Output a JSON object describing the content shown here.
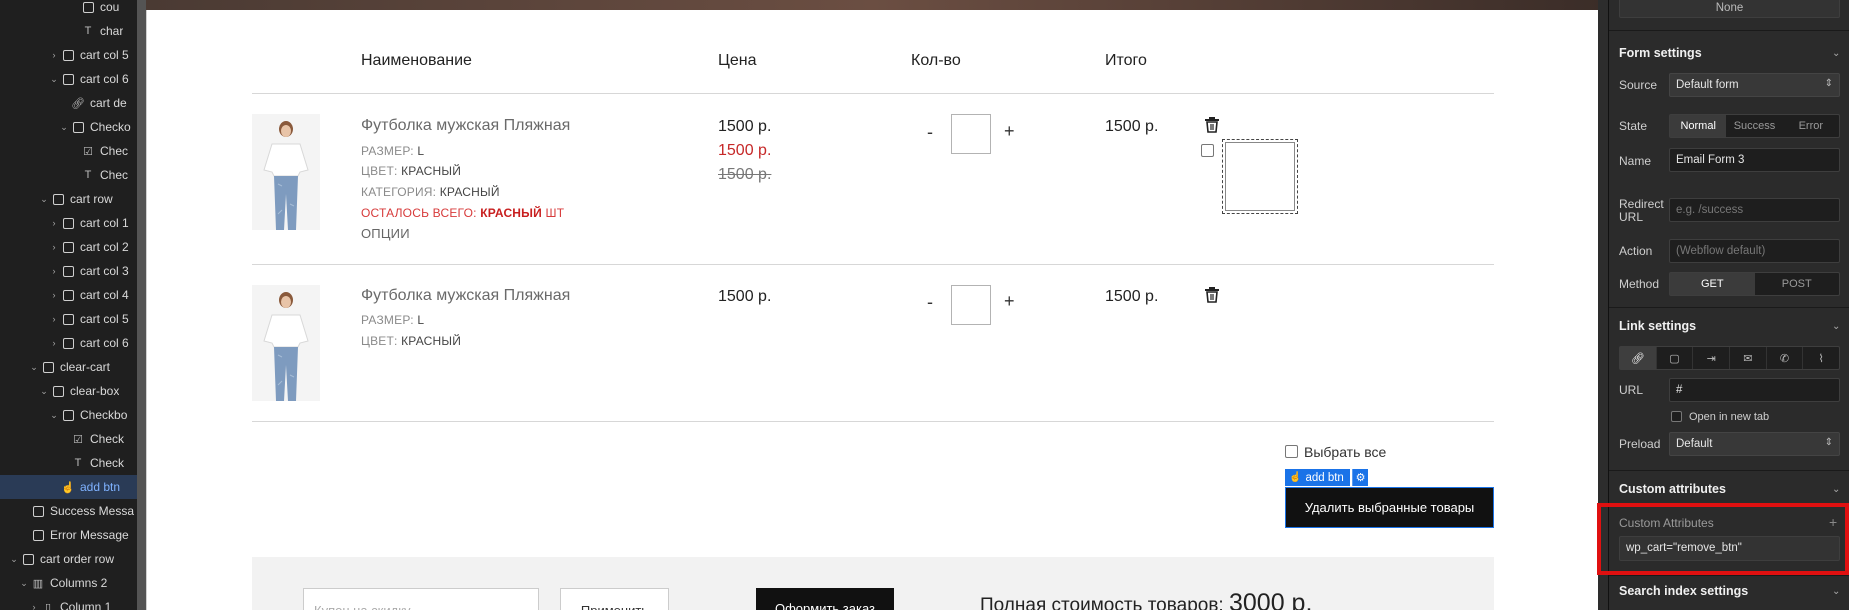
{
  "navigator": {
    "rows": [
      {
        "label": "cou",
        "icon": "box-icon",
        "depth": 6,
        "caret": ""
      },
      {
        "label": "char",
        "icon": "text-icon",
        "depth": 6,
        "caret": ""
      },
      {
        "label": "cart col 5",
        "icon": "box-icon",
        "depth": 4,
        "caret": "›"
      },
      {
        "label": "cart col 6",
        "icon": "box-icon",
        "depth": 4,
        "caret": "⌄"
      },
      {
        "label": "cart de",
        "icon": "link-icon",
        "depth": 5,
        "caret": ""
      },
      {
        "label": "Checko",
        "icon": "box-icon",
        "depth": 5,
        "caret": "⌄"
      },
      {
        "label": "Chec",
        "icon": "checkbox-icon",
        "depth": 6,
        "caret": ""
      },
      {
        "label": "Chec",
        "icon": "text-icon",
        "depth": 6,
        "caret": ""
      },
      {
        "label": "cart row",
        "icon": "box-icon",
        "depth": 3,
        "caret": "⌄"
      },
      {
        "label": "cart col 1",
        "icon": "box-icon",
        "depth": 4,
        "caret": "›"
      },
      {
        "label": "cart col 2",
        "icon": "box-icon",
        "depth": 4,
        "caret": "›"
      },
      {
        "label": "cart col 3",
        "icon": "box-icon",
        "depth": 4,
        "caret": "›"
      },
      {
        "label": "cart col 4",
        "icon": "box-icon",
        "depth": 4,
        "caret": "›"
      },
      {
        "label": "cart col 5",
        "icon": "box-icon",
        "depth": 4,
        "caret": "›"
      },
      {
        "label": "cart col 6",
        "icon": "box-icon",
        "depth": 4,
        "caret": "›"
      },
      {
        "label": "clear-cart",
        "icon": "box-icon",
        "depth": 2,
        "caret": "⌄"
      },
      {
        "label": "clear-box",
        "icon": "box-icon",
        "depth": 3,
        "caret": "⌄"
      },
      {
        "label": "Checkbo",
        "icon": "box-icon",
        "depth": 4,
        "caret": "⌄"
      },
      {
        "label": "Check",
        "icon": "checkbox-icon",
        "depth": 5,
        "caret": ""
      },
      {
        "label": "Check",
        "icon": "text-icon",
        "depth": 5,
        "caret": ""
      },
      {
        "label": "add btn",
        "icon": "pointer-icon",
        "depth": 4,
        "caret": "",
        "selected": true
      },
      {
        "label": "Success Messa",
        "icon": "box-icon",
        "depth": 1,
        "caret": ""
      },
      {
        "label": "Error Message",
        "icon": "box-icon",
        "depth": 1,
        "caret": ""
      },
      {
        "label": "cart order row",
        "icon": "box-icon",
        "depth": 0,
        "caret": "⌄"
      },
      {
        "label": "Columns 2",
        "icon": "columns-icon",
        "depth": 1,
        "caret": "⌄"
      },
      {
        "label": "Column 1",
        "icon": "column-icon",
        "depth": 2,
        "caret": "›"
      }
    ]
  },
  "cart": {
    "headers": {
      "name": "Наименование",
      "price": "Цена",
      "qty": "Кол-во",
      "total": "Итого"
    },
    "item1": {
      "name": "Футболка мужская Пляжная",
      "size_label": "РАЗМЕР:",
      "size_value": "L",
      "color_label": "ЦВЕТ:",
      "color_value": "КРАСНЫЙ",
      "cat_label": "КАТЕГОРИЯ:",
      "cat_value": "КРАСНЫЙ",
      "left_label": "ОСТАЛОСЬ ВСЕГО:",
      "left_value": "КРАСНЫЙ",
      "left_unit": "ШТ",
      "options": "ОПЦИИ",
      "price": "1500 р.",
      "price_sale": "1500 р.",
      "price_old": "1500 р.",
      "minus": "-",
      "plus": "+",
      "qty": "",
      "total": "1500 р."
    },
    "item2": {
      "name": "Футболка мужская Пляжная",
      "size_label": "РАЗМЕР:",
      "size_value": "L",
      "color_label": "ЦВЕТ:",
      "color_value": "КРАСНЫЙ",
      "price": "1500 р.",
      "minus": "-",
      "plus": "+",
      "qty": "",
      "total": "1500 р."
    },
    "select_all": "Выбрать все",
    "add_btn_tag": "add btn",
    "delete_selected": "Удалить выбранные товары",
    "coupon_placeholder": "Купон на скидку",
    "apply": "Применить",
    "checkout": "Оформить заказ",
    "total_label": "Полная стоимость товаров:",
    "total_sum": "3000 р."
  },
  "panel": {
    "none_value": "None",
    "form_settings": {
      "title": "Form settings",
      "source_label": "Source",
      "source_value": "Default form",
      "state_label": "State",
      "states": [
        "Normal",
        "Success",
        "Error"
      ],
      "state_active": "Normal",
      "name_label": "Name",
      "name_value": "Email Form 3",
      "redirect_label_1": "Redirect",
      "redirect_label_2": "URL",
      "redirect_placeholder": "e.g. /success",
      "action_label": "Action",
      "action_placeholder": "(Webflow default)",
      "method_label": "Method",
      "methods": [
        "GET",
        "POST"
      ],
      "method_active": "GET"
    },
    "link_settings": {
      "title": "Link settings",
      "link_types": [
        "link-icon",
        "page-icon",
        "section-icon",
        "email-icon",
        "phone-icon",
        "attachment-icon"
      ],
      "url_label": "URL",
      "url_value": "#",
      "new_tab": "Open in new tab",
      "preload_label": "Preload",
      "preload_value": "Default"
    },
    "custom_attributes": {
      "title": "Custom attributes",
      "sub_label": "Custom Attributes",
      "attr": "wp_cart=\"remove_btn\""
    },
    "search_index": {
      "title": "Search index settings"
    },
    "highlight_color": "#e01010",
    "accent_color": "#1a73e8"
  }
}
